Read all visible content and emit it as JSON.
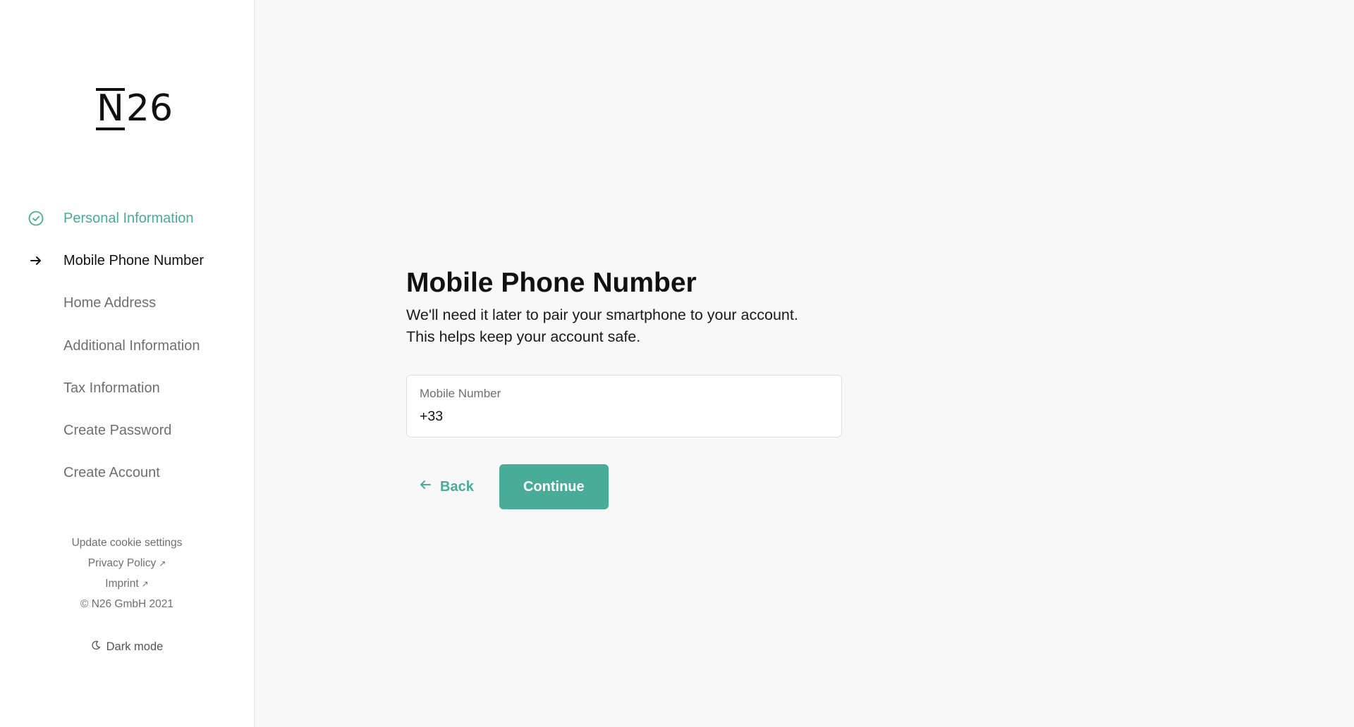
{
  "brand": {
    "logo_text_n": "N",
    "logo_text_digits": "26",
    "accent_color": "#48ac98"
  },
  "sidebar": {
    "steps": [
      {
        "label": "Personal Information",
        "state": "done",
        "icon": "check-circle-icon"
      },
      {
        "label": "Mobile Phone Number",
        "state": "current",
        "icon": "arrow-right-icon"
      },
      {
        "label": "Home Address",
        "state": "pending"
      },
      {
        "label": "Additional Information",
        "state": "pending"
      },
      {
        "label": "Tax Information",
        "state": "pending"
      },
      {
        "label": "Create Password",
        "state": "pending"
      },
      {
        "label": "Create Account",
        "state": "pending"
      }
    ],
    "footer": {
      "cookie_settings": "Update cookie settings",
      "privacy_policy": "Privacy Policy",
      "imprint": "Imprint",
      "copyright": "© N26 GmbH 2021",
      "external_link_icon": "external-link-icon"
    },
    "dark_mode": {
      "label": "Dark mode",
      "icon": "moon-icon"
    }
  },
  "main": {
    "title": "Mobile Phone Number",
    "subtitle_line1": "We'll need it later to pair your smartphone to your account.",
    "subtitle_line2": "This helps keep your account safe.",
    "mobile_field": {
      "label": "Mobile Number",
      "value": "+33"
    },
    "back_label": "Back",
    "continue_label": "Continue"
  }
}
